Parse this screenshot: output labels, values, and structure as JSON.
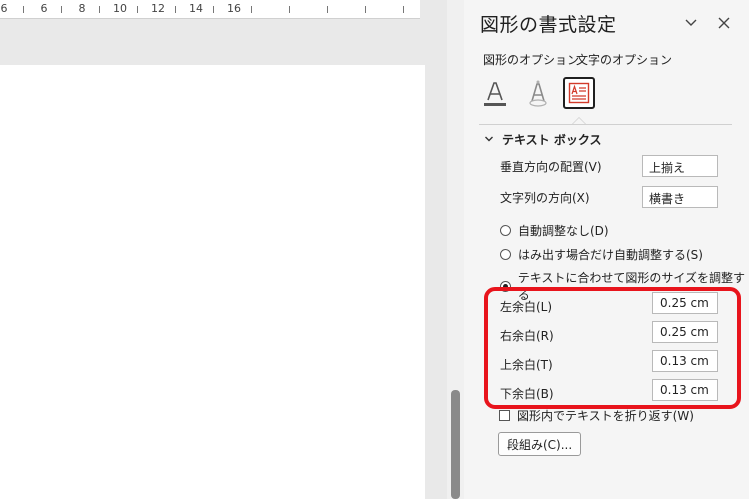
{
  "ruler": {
    "numbers": [
      "6",
      "8",
      "10",
      "12",
      "14",
      "16"
    ],
    "partial_left": "6"
  },
  "pane": {
    "title": "図形の書式設定",
    "dropdown_icon": "chevron-down-icon",
    "close_icon": "close-icon",
    "tabs": [
      "図形のオプション",
      "文字のオプション"
    ],
    "icons": [
      "text-fill-outline-icon",
      "text-effects-icon",
      "textbox-layout-icon"
    ],
    "section": {
      "title": "テキスト ボックス",
      "vertical_align_label": "垂直方向の配置(V)",
      "vertical_align_value": "上揃え",
      "text_direction_label": "文字列の方向(X)",
      "text_direction_value": "横書き",
      "autofit_options": [
        {
          "label": "自動調整なし(D)",
          "selected": false
        },
        {
          "label": "はみ出す場合だけ自動調整する(S)",
          "selected": false
        },
        {
          "label": "テキストに合わせて図形のサイズを調整する",
          "selected": true
        }
      ],
      "margins": {
        "left_label": "左余白(L)",
        "left_value": "0.25 cm",
        "right_label": "右余白(R)",
        "right_value": "0.25 cm",
        "top_label": "上余白(T)",
        "top_value": "0.13 cm",
        "bottom_label": "下余白(B)",
        "bottom_value": "0.13 cm"
      },
      "wrap_label": "図形内でテキストを折り返す(W)",
      "wrap_checked": false,
      "columns_button": "段組み(C)..."
    }
  },
  "colors": {
    "highlight": "#e8141c",
    "pane_bg": "#f5f5f5",
    "scroll_thumb": "#8a8a8a"
  }
}
